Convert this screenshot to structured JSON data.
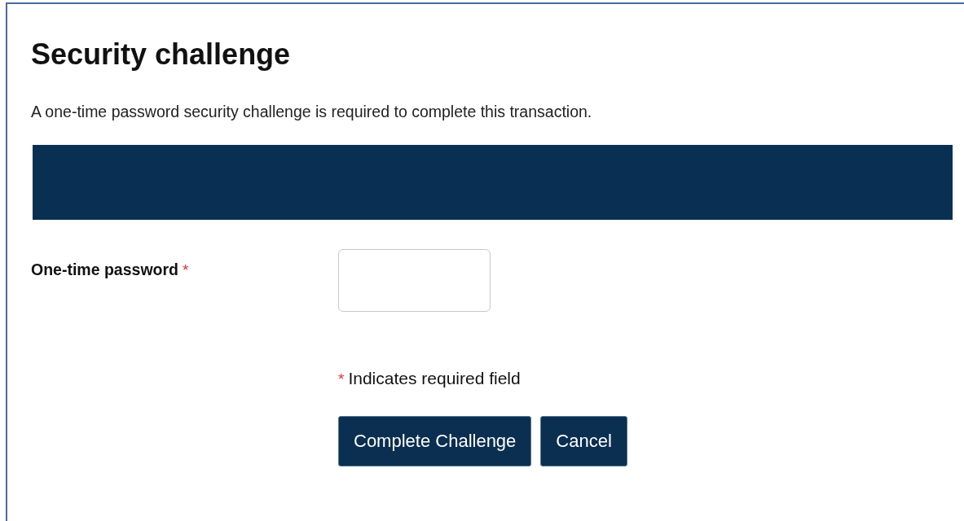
{
  "title": "Security challenge",
  "description": "A one-time password security challenge is required to complete this transaction.",
  "field": {
    "label": "One-time password",
    "required_mark": "*"
  },
  "legend": {
    "mark": "*",
    "text": "Indicates required field"
  },
  "buttons": [
    {
      "label": "Complete Challenge"
    },
    {
      "label": "Cancel"
    }
  ]
}
